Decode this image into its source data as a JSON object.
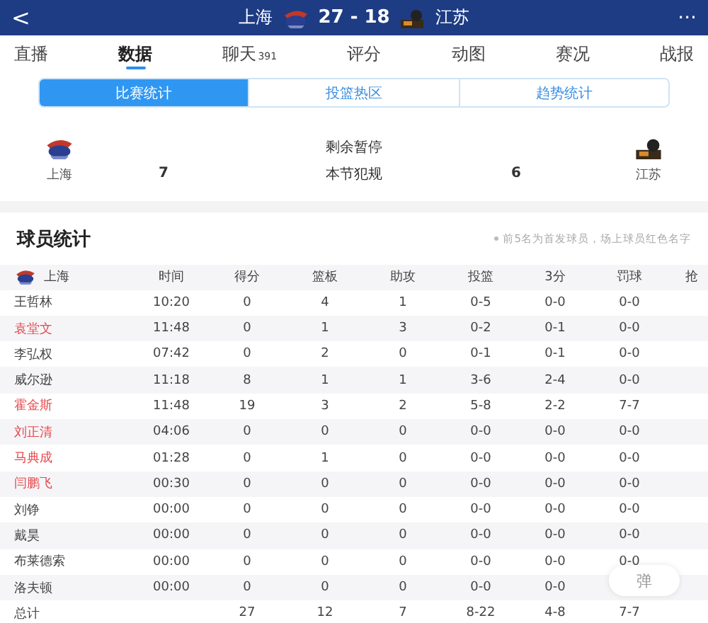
{
  "header": {
    "back": "<",
    "home_team": "上海",
    "score": "27 - 18",
    "away_team": "江苏",
    "more": "···"
  },
  "tabs": [
    {
      "label": "直播",
      "selected": false
    },
    {
      "label": "数据",
      "selected": true
    },
    {
      "label": "聊天",
      "count": "391",
      "selected": false
    },
    {
      "label": "评分",
      "selected": false
    },
    {
      "label": "动图",
      "selected": false
    },
    {
      "label": "赛况",
      "selected": false
    },
    {
      "label": "战报",
      "selected": false
    }
  ],
  "segments": [
    {
      "label": "比赛统计",
      "selected": true
    },
    {
      "label": "投篮热区",
      "selected": false
    },
    {
      "label": "趋势统计",
      "selected": false
    }
  ],
  "team_info": {
    "home": "上海",
    "away": "江苏",
    "labels": [
      "剩余暂停",
      "本节犯规"
    ],
    "home_value": "7",
    "away_value": "6"
  },
  "player_stats": {
    "title": "球员统计",
    "note": "前5名为首发球员，场上球员红色名字",
    "team": "上海",
    "columns": [
      "时间",
      "得分",
      "篮板",
      "助攻",
      "投篮",
      "3分",
      "罚球",
      "抢"
    ],
    "rows": [
      {
        "name": "王哲林",
        "on_court": false,
        "values": [
          "10:20",
          "0",
          "4",
          "1",
          "0-5",
          "0-0",
          "0-0"
        ]
      },
      {
        "name": "袁堂文",
        "on_court": true,
        "values": [
          "11:48",
          "0",
          "1",
          "3",
          "0-2",
          "0-1",
          "0-0"
        ]
      },
      {
        "name": "李弘权",
        "on_court": false,
        "values": [
          "07:42",
          "0",
          "2",
          "0",
          "0-1",
          "0-1",
          "0-0"
        ]
      },
      {
        "name": "威尔逊",
        "on_court": false,
        "values": [
          "11:18",
          "8",
          "1",
          "1",
          "3-6",
          "2-4",
          "0-0"
        ]
      },
      {
        "name": "霍金斯",
        "on_court": true,
        "values": [
          "11:48",
          "19",
          "3",
          "2",
          "5-8",
          "2-2",
          "7-7"
        ]
      },
      {
        "name": "刘正清",
        "on_court": true,
        "values": [
          "04:06",
          "0",
          "0",
          "0",
          "0-0",
          "0-0",
          "0-0"
        ]
      },
      {
        "name": "马典成",
        "on_court": true,
        "values": [
          "01:28",
          "0",
          "1",
          "0",
          "0-0",
          "0-0",
          "0-0"
        ]
      },
      {
        "name": "闫鹏飞",
        "on_court": true,
        "values": [
          "00:30",
          "0",
          "0",
          "0",
          "0-0",
          "0-0",
          "0-0"
        ]
      },
      {
        "name": "刘铮",
        "on_court": false,
        "values": [
          "00:00",
          "0",
          "0",
          "0",
          "0-0",
          "0-0",
          "0-0"
        ]
      },
      {
        "name": "戴昊",
        "on_court": false,
        "values": [
          "00:00",
          "0",
          "0",
          "0",
          "0-0",
          "0-0",
          "0-0"
        ]
      },
      {
        "name": "布莱德索",
        "on_court": false,
        "values": [
          "00:00",
          "0",
          "0",
          "0",
          "0-0",
          "0-0",
          "0-0"
        ]
      },
      {
        "name": "洛夫顿",
        "on_court": false,
        "values": [
          "00:00",
          "0",
          "0",
          "0",
          "0-0",
          "0-0"
        ]
      }
    ],
    "total": {
      "label": "总计",
      "values": [
        "27",
        "12",
        "7",
        "8-22",
        "4-8",
        "7-7"
      ]
    }
  },
  "float_button": "弹"
}
